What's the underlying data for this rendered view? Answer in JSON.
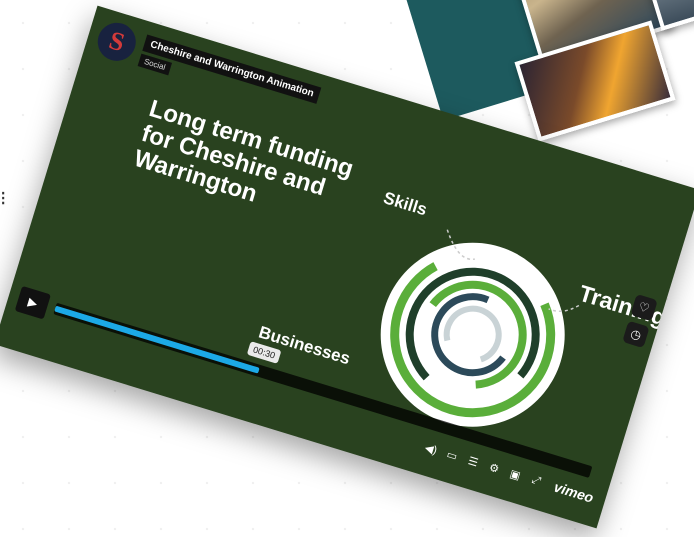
{
  "channel": {
    "title": "Cheshire and Warrington Animation",
    "subtitle": "Social",
    "logo_letter": "S"
  },
  "video": {
    "headline": "Long term funding for Cheshire and Warrington",
    "labels": {
      "skills": "Skills",
      "training": "Training",
      "businesses": "Businesses"
    },
    "current_time": "00:30",
    "progress_fraction": 0.38
  },
  "controls": {
    "play": "▶",
    "brand": "vimeo"
  },
  "icons": [
    "heart-icon",
    "clock-icon",
    "play-icon",
    "volume-icon",
    "captions-icon",
    "transcript-icon",
    "settings-gear-icon",
    "pip-icon",
    "fullscreen-icon"
  ],
  "colors": {
    "player_bg": "#29421f",
    "progress": "#1ca9e6",
    "ring_green": "#5aae3a",
    "ring_dark": "#1f3f2a"
  }
}
